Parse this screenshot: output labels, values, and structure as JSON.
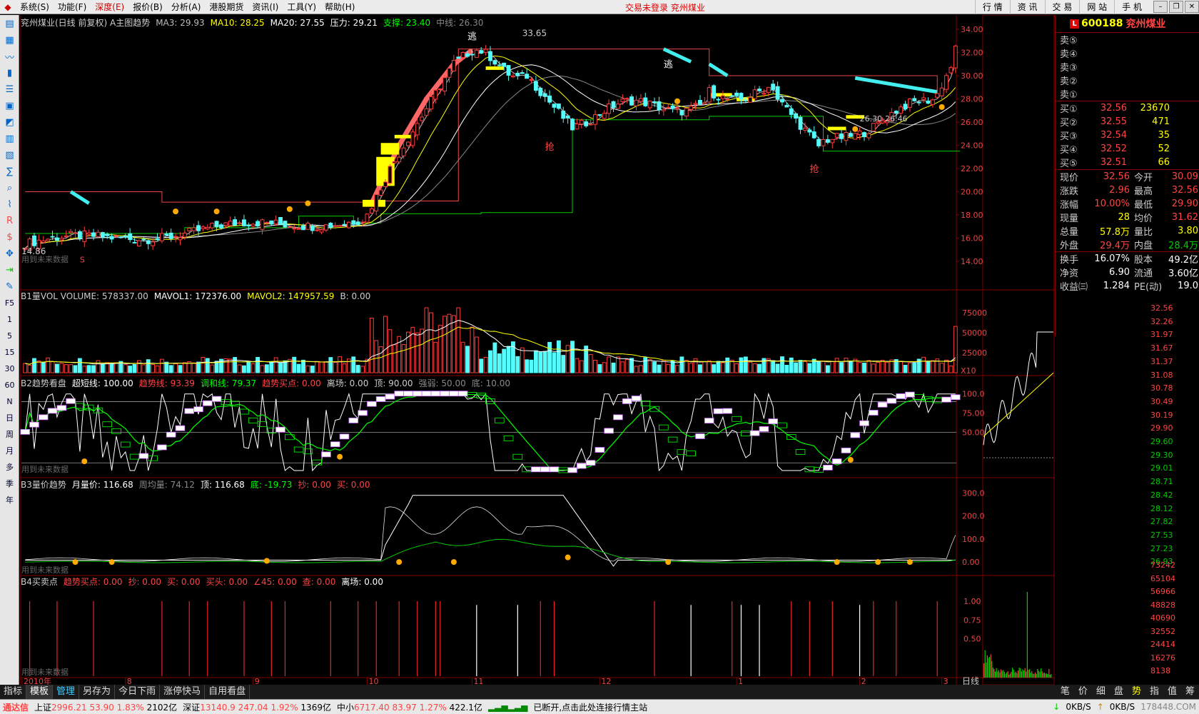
{
  "menu": {
    "items": [
      "系统(S)",
      "功能(F)",
      "深度(E)",
      "报价(B)",
      "分析(A)",
      "港股期货",
      "资讯(I)",
      "工具(Y)",
      "帮助(H)"
    ],
    "center_text": "交易未登录 兖州煤业",
    "right_tabs": [
      "行 情",
      "资 讯",
      "交 易",
      "网 站",
      "手 机"
    ],
    "win_buttons": [
      "–",
      "❐",
      "✕"
    ]
  },
  "left_toolbar": [
    "F5",
    "1",
    "5",
    "15",
    "30",
    "60",
    "N",
    "日",
    "周",
    "月",
    "多",
    "季",
    "年"
  ],
  "main_panel": {
    "header": [
      {
        "t": "兖州煤业(日线 前复权) A主图趋势",
        "c": "#ccc"
      },
      {
        "t": "MA3: 29.93",
        "c": "#bbb"
      },
      {
        "t": "MA10: 28.25",
        "c": "#ff0"
      },
      {
        "t": "MA20: 27.55",
        "c": "#fff"
      },
      {
        "t": "压力: 29.21",
        "c": "#fff"
      },
      {
        "t": "支撑: 23.40",
        "c": "#0f0"
      },
      {
        "t": "中线: 26.30",
        "c": "#888"
      }
    ],
    "yticks": [
      "34.00",
      "32.00",
      "30.00",
      "28.00",
      "26.00",
      "24.00",
      "22.00",
      "20.00",
      "18.00",
      "16.00",
      "14.00"
    ],
    "annotations": {
      "high": "33.65",
      "low": "14.86",
      "range": "26.30-26.46",
      "escape1": "逃",
      "escape2": "逃",
      "grab1": "抢",
      "grab2": "抢",
      "s_mark": "S",
      "future_note": "用到未来数据"
    }
  },
  "vol_panel": {
    "header": [
      {
        "t": "B1量VOL VOLUME: 578337.00",
        "c": "#ccc"
      },
      {
        "t": "MAVOL1: 172376.00",
        "c": "#fff"
      },
      {
        "t": "MAVOL2: 147957.59",
        "c": "#ff0"
      },
      {
        "t": "B: 0.00",
        "c": "#ccc"
      }
    ],
    "yticks": [
      "75000",
      "50000",
      "25000"
    ],
    "unit": "X10"
  },
  "trend_panel": {
    "header": [
      {
        "t": "B2趋势看盘",
        "c": "#ccc"
      },
      {
        "t": "超短线: 100.00",
        "c": "#fff"
      },
      {
        "t": "趋势线: 93.39",
        "c": "#f44"
      },
      {
        "t": "调和线: 79.37",
        "c": "#0f0"
      },
      {
        "t": "趋势买点: 0.00",
        "c": "#f44"
      },
      {
        "t": "离场: 0.00",
        "c": "#ccc"
      },
      {
        "t": "顶: 90.00",
        "c": "#ccc"
      },
      {
        "t": "强弱: 50.00",
        "c": "#888"
      },
      {
        "t": "底: 10.00",
        "c": "#888"
      }
    ],
    "yticks": [
      "100.0",
      "75.00",
      "50.00"
    ],
    "future_note": "用到未来数据"
  },
  "price_trend_panel": {
    "header": [
      {
        "t": "B3量价趋势",
        "c": "#ccc"
      },
      {
        "t": "月量价: 116.68",
        "c": "#fff"
      },
      {
        "t": "周均量: 74.12",
        "c": "#888"
      },
      {
        "t": "顶: 116.68",
        "c": "#fff"
      },
      {
        "t": "底: -19.73",
        "c": "#0f0"
      },
      {
        "t": "抄: 0.00",
        "c": "#f44"
      },
      {
        "t": "买: 0.00",
        "c": "#f44"
      }
    ],
    "yticks": [
      "300.0",
      "200.0",
      "100.0",
      "0.00"
    ],
    "future_note": "用到未来数据"
  },
  "signal_panel": {
    "header": [
      {
        "t": "B4买卖点",
        "c": "#ccc"
      },
      {
        "t": "趋势买点: 0.00",
        "c": "#f44"
      },
      {
        "t": "抄: 0.00",
        "c": "#f44"
      },
      {
        "t": "买: 0.00",
        "c": "#f44"
      },
      {
        "t": "买头: 0.00",
        "c": "#f44"
      },
      {
        "t": "∠45: 0.00",
        "c": "#f44"
      },
      {
        "t": "查: 0.00",
        "c": "#f44"
      },
      {
        "t": "离场: 0.00",
        "c": "#fff"
      }
    ],
    "yticks": [
      "1.00",
      "0.75",
      "0.50"
    ],
    "future_note": "用到未来数据"
  },
  "x_axis": {
    "labels": [
      "2010年",
      "8",
      "9",
      "10",
      "11",
      "12",
      "1",
      "2",
      "3"
    ],
    "period": "日线"
  },
  "quote": {
    "code": "600188",
    "name": "兖州煤业",
    "flag": "L",
    "asks": [
      [
        "卖⑤",
        "",
        ""
      ],
      [
        "卖④",
        "",
        ""
      ],
      [
        "卖③",
        "",
        ""
      ],
      [
        "卖②",
        "",
        ""
      ],
      [
        "卖①",
        "",
        ""
      ]
    ],
    "bids": [
      [
        "买①",
        "32.56",
        "23670"
      ],
      [
        "买②",
        "32.55",
        "471"
      ],
      [
        "买③",
        "32.54",
        "35"
      ],
      [
        "买④",
        "32.52",
        "52"
      ],
      [
        "买⑤",
        "32.51",
        "66"
      ]
    ],
    "stats": [
      [
        "现价",
        "32.56",
        "今开",
        "30.09"
      ],
      [
        "涨跌",
        "2.96",
        "最高",
        "32.56"
      ],
      [
        "涨幅",
        "10.00%",
        "最低",
        "29.90"
      ],
      [
        "现量",
        "28",
        "均价",
        "31.62"
      ],
      [
        "总量",
        "57.8万",
        "量比",
        "3.80"
      ],
      [
        "外盘",
        "29.4万",
        "内盘",
        "28.4万"
      ]
    ],
    "stats2": [
      [
        "换手",
        "16.07%",
        "股本",
        "49.2亿"
      ],
      [
        "净资",
        "6.90",
        "流通",
        "3.60亿"
      ],
      [
        "收益㈢",
        "1.284",
        "PE(动)",
        "19.0"
      ]
    ]
  },
  "intraday": {
    "price_ticks": [
      "32.56",
      "32.26",
      "31.97",
      "31.67",
      "31.37",
      "31.08",
      "30.78",
      "30.49",
      "30.19",
      "29.90",
      "29.60",
      "29.30",
      "29.01",
      "28.71",
      "28.42",
      "28.12",
      "27.82",
      "27.53",
      "27.23",
      "26.93"
    ],
    "vol_ticks": [
      "73242",
      "65104",
      "56966",
      "48828",
      "40690",
      "32552",
      "24414",
      "16276",
      "8138"
    ]
  },
  "bottom_tabs": [
    "指标",
    "模板",
    "管理",
    "另存为",
    "今日下雨",
    "涨停快马",
    "自用看盘"
  ],
  "bottom_right_tabs": [
    "笔",
    "价",
    "细",
    "盘",
    "势",
    "指",
    "值",
    "筹"
  ],
  "status": {
    "brand": "通达信",
    "sh": {
      "name": "上证",
      "value": "2996.21",
      "chg": "53.90",
      "pct": "1.83%",
      "amt": "2102亿"
    },
    "sz": {
      "name": "深证",
      "value": "13140.9",
      "chg": "247.04",
      "pct": "1.92%",
      "amt": "1369亿"
    },
    "zx": {
      "name": "中小",
      "value": "6717.40",
      "chg": "83.97",
      "pct": "1.27%",
      "amt": "422.1亿"
    },
    "msg": "已断开,点击此处连接行情主站",
    "down": "0KB/S",
    "up": "0KB/S",
    "watermark": "178448.COM"
  },
  "colors": {
    "up": "#ff3c3c",
    "down": "#54fcfc",
    "grid": "#800000",
    "ma_white": "#ffffff",
    "ma_yellow": "#ffff00",
    "support": "#00c000"
  }
}
